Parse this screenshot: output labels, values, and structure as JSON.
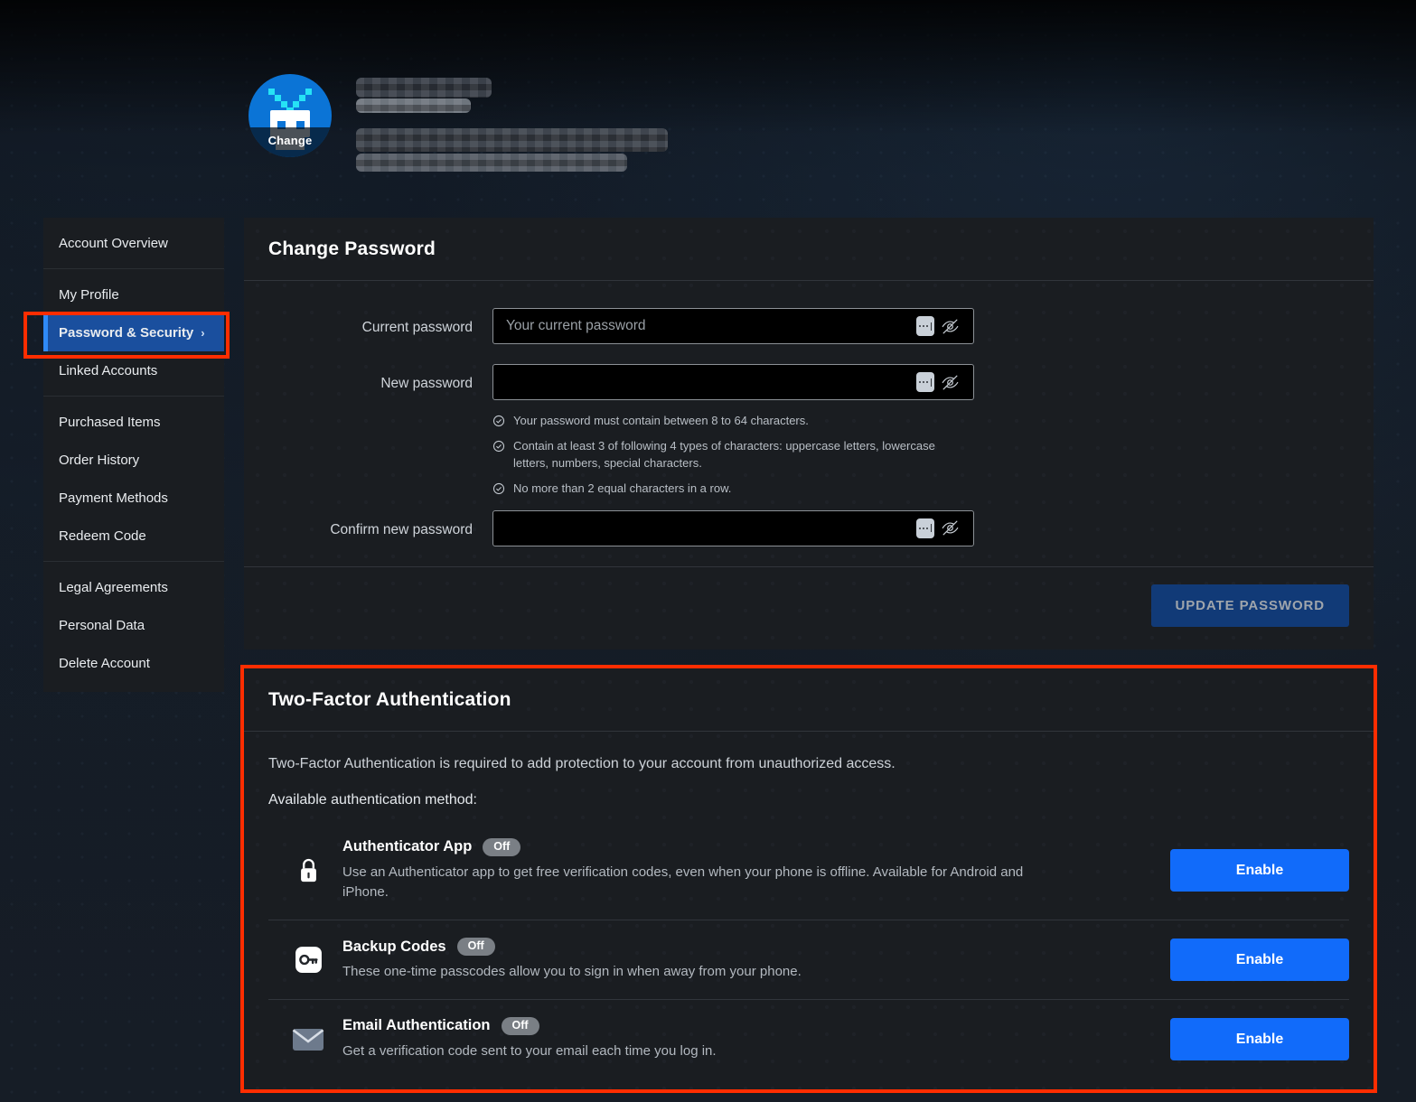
{
  "profile": {
    "avatar": {
      "change_label": "Change",
      "icon": "robot-avatar-icon"
    },
    "name_redacted": true,
    "details_redacted": true
  },
  "sidebar": {
    "groups": [
      {
        "items": [
          {
            "label": "Account Overview",
            "active": false
          }
        ]
      },
      {
        "items": [
          {
            "label": "My Profile",
            "active": false
          },
          {
            "label": "Password & Security",
            "active": true,
            "chevron": "›"
          },
          {
            "label": "Linked Accounts",
            "active": false
          }
        ]
      },
      {
        "items": [
          {
            "label": "Purchased Items",
            "active": false
          },
          {
            "label": "Order History",
            "active": false
          },
          {
            "label": "Payment Methods",
            "active": false
          },
          {
            "label": "Redeem Code",
            "active": false
          }
        ]
      },
      {
        "items": [
          {
            "label": "Legal Agreements",
            "active": false
          },
          {
            "label": "Personal Data",
            "active": false
          },
          {
            "label": "Delete Account",
            "active": false
          }
        ]
      }
    ]
  },
  "change_password": {
    "title": "Change Password",
    "fields": {
      "current": {
        "label": "Current password",
        "value": "",
        "placeholder": "Your current password"
      },
      "new": {
        "label": "New password",
        "value": "",
        "placeholder": ""
      },
      "confirm": {
        "label": "Confirm new password",
        "value": "",
        "placeholder": ""
      }
    },
    "rules": [
      "Your password must contain between 8 to 64 characters.",
      "Contain at least 3 of following 4 types of characters: uppercase letters, lowercase letters, numbers, special characters.",
      "No more than 2 equal characters in a row."
    ],
    "update_button": "UPDATE PASSWORD"
  },
  "two_factor": {
    "title": "Two-Factor Authentication",
    "lead": "Two-Factor Authentication is required to add protection to your account from unauthorized access.",
    "subheading": "Available authentication method:",
    "methods": [
      {
        "icon": "lock-icon",
        "title": "Authenticator App",
        "status": "Off",
        "description": "Use an Authenticator app to get free verification codes, even when your phone is offline. Available for Android and iPhone.",
        "action": "Enable"
      },
      {
        "icon": "key-icon",
        "title": "Backup Codes",
        "status": "Off",
        "description": "These one-time passcodes allow you to sign in when away from your phone.",
        "action": "Enable"
      },
      {
        "icon": "envelope-icon",
        "title": "Email Authentication",
        "status": "Off",
        "description": "Get a verification code sent to your email each time you log in.",
        "action": "Enable"
      }
    ]
  },
  "colors": {
    "accent_blue": "#116bfa",
    "active_nav_blue": "#1a4f9e",
    "nav_accent_bar": "#2f8af7",
    "panel_bg": "#1a1d21",
    "page_bg": "#141b24",
    "annotation_red": "#ff2d00",
    "badge_gray": "#7a7f85",
    "disabled_button_blue": "#113a77"
  }
}
